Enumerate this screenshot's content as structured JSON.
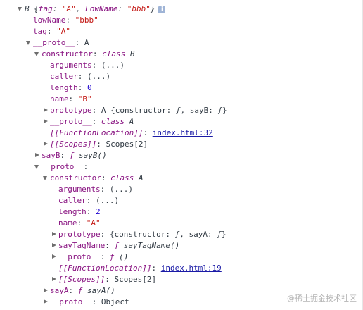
{
  "summary": {
    "name": "B",
    "open": "{",
    "tag_key": "tag",
    "tag_val": "\"A\"",
    "comma": ",",
    "lowname_key": "LowName",
    "lowname_val": "\"bbb\"",
    "close": "}",
    "info_icon": "i"
  },
  "own_props": {
    "lowname_key": "lowName",
    "lowname_val": "\"bbb\"",
    "tag_key": "tag",
    "tag_val": "\"A\""
  },
  "proto1": {
    "key": "__proto__",
    "value": "A",
    "constructor": {
      "key": "constructor",
      "kw": "class",
      "name": "B",
      "arguments_key": "arguments",
      "arguments_val": "(...)",
      "caller_key": "caller",
      "caller_val": "(...)",
      "length_key": "length",
      "length_val": "0",
      "name_key": "name",
      "name_val": "\"B\"",
      "prototype_key": "prototype",
      "prototype_val": "A {constructor: ",
      "prototype_f1": "ƒ",
      "prototype_mid": ", sayB: ",
      "prototype_f2": "ƒ",
      "prototype_end": "}",
      "proto_key": "__proto__",
      "proto_kw": "class",
      "proto_name": "A",
      "fnloc_key": "[[FunctionLocation]]",
      "fnloc_link": "index.html:32",
      "scopes_key": "[[Scopes]]",
      "scopes_val": "Scopes[2]"
    },
    "sayB_key": "sayB",
    "sayB_f": "ƒ",
    "sayB_name": "sayB()"
  },
  "proto2": {
    "key": "__proto__",
    "value": "",
    "constructor": {
      "key": "constructor",
      "kw": "class",
      "name": "A",
      "arguments_key": "arguments",
      "arguments_val": "(...)",
      "caller_key": "caller",
      "caller_val": "(...)",
      "length_key": "length",
      "length_val": "2",
      "name_key": "name",
      "name_val": "\"A\"",
      "prototype_key": "prototype",
      "prototype_val": "{constructor: ",
      "prototype_f1": "ƒ",
      "prototype_mid": ", sayA: ",
      "prototype_f2": "ƒ",
      "prototype_end": "}",
      "saytag_key": "sayTagName",
      "saytag_f": "ƒ",
      "saytag_name": "sayTagName()",
      "proto_key": "__proto__",
      "proto_f": "ƒ",
      "proto_val": "()",
      "fnloc_key": "[[FunctionLocation]]",
      "fnloc_link": "index.html:19",
      "scopes_key": "[[Scopes]]",
      "scopes_val": "Scopes[2]"
    },
    "sayA_key": "sayA",
    "sayA_f": "ƒ",
    "sayA_name": "sayA()",
    "proto_key": "__proto__",
    "proto_val": "Object"
  },
  "watermark": "@稀土掘金技术社区"
}
